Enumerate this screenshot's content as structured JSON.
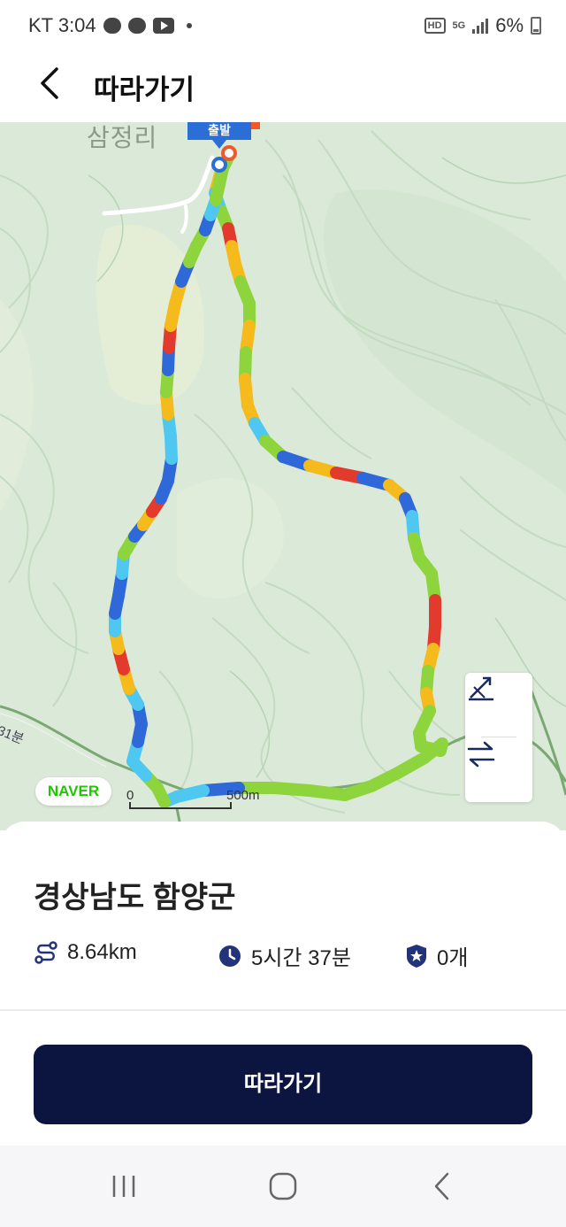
{
  "status_bar": {
    "carrier_time": "KT 3:04",
    "app_icons": [
      "kakaotalk-icon",
      "chat-icon",
      "youtube-icon"
    ],
    "hd_label": "HD",
    "network": "5G",
    "battery": "6%"
  },
  "header": {
    "title": "따라가기"
  },
  "map": {
    "place_label": "삼정리",
    "start_flag_text": "출발",
    "road_label": "31분",
    "provider": "NAVER",
    "scale_start": "0",
    "scale_end": "500m",
    "route_colors": {
      "green": "#8ed43c",
      "yellow": "#f5bb1c",
      "light_blue": "#4ec8f0",
      "blue": "#2f68d8",
      "red": "#e23b2e"
    },
    "tools": [
      "slope-icon",
      "swap-icon"
    ]
  },
  "trail": {
    "region": "경상남도 함양군",
    "distance": "8.64km",
    "duration": "5시간 37분",
    "badge_count": "0개"
  },
  "action": {
    "follow_label": "따라가기"
  },
  "nav_bar": {
    "buttons": [
      "recent-apps",
      "home",
      "back"
    ]
  }
}
